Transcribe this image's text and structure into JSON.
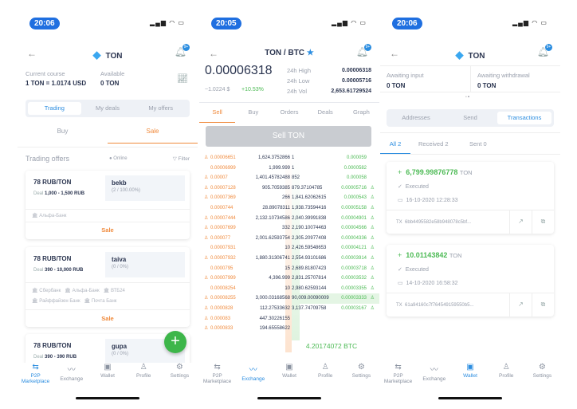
{
  "colors": {
    "accent": "#2b8de0",
    "sell": "#f08a3c",
    "buy": "#4cba54",
    "fab": "#3db64a"
  },
  "p1": {
    "time": "20:06",
    "title": "TON",
    "bell_badge": "9+",
    "course_label": "Current course",
    "course_value": "1 TON = 1.0174 USD",
    "available_label": "Available",
    "available_value": "0 TON",
    "seg": [
      "Trading",
      "My deals",
      "My offers"
    ],
    "tabs": [
      "Buy",
      "Sale"
    ],
    "offers_title": "Trading offers",
    "online": "Online",
    "filter": "Filter",
    "offers": [
      {
        "price": "78 RUB/TON",
        "deal_label": "Deal",
        "deal": "1,000 - 1,500 RUB",
        "user": "bekb",
        "stats": "(2 / 100.00%)",
        "banks": [
          "Альфа-Банк"
        ],
        "action": "Sale"
      },
      {
        "price": "78 RUB/TON",
        "deal_label": "Deal",
        "deal": "390 - 10,000 RUB",
        "user": "taiva",
        "stats": "(0 / 0%)",
        "banks": [
          "Сбербанк",
          "Альфа-Банк",
          "ВТБ24",
          "Райффайзен Банк",
          "Почта Банк"
        ],
        "action": "Sale"
      },
      {
        "price": "78 RUB/TON",
        "deal_label": "Deal",
        "deal": "390 - 390 RUB",
        "user": "gupa",
        "stats": "(0 / 0%)"
      }
    ],
    "fab": "+"
  },
  "p2": {
    "time": "20:05",
    "pair": "TON / BTC",
    "price": "0.00006318",
    "usd": "~1.0224 $",
    "change": "+10.53%",
    "high_label": "24h High",
    "high": "0.00006318",
    "low_label": "24h Low",
    "low": "0.00005716",
    "vol_label": "24h Vol",
    "vol": "2,653.61729524",
    "tabs": [
      "Sell",
      "Buy",
      "Orders",
      "Deals",
      "Graph"
    ],
    "sell_button": "Sell TON",
    "total": "4.20174072 BTC",
    "rows": [
      [
        "0.00006651",
        "1,624.3752866",
        "1",
        "0.000059",
        1,
        0
      ],
      [
        "0.00006999",
        "1,999.999",
        "1",
        "0.0000582",
        0,
        0
      ],
      [
        "0.00007",
        "1,401.45782488",
        "852",
        "0.000058",
        1,
        0
      ],
      [
        "0.00007128",
        "905.7059385",
        "879.37104785",
        "0.00005716",
        1,
        1
      ],
      [
        "0.00007369",
        "266",
        "1,841.62062615",
        "0.0000543",
        1,
        1
      ],
      [
        "0.0000744",
        "28.89078311",
        "1,938.73594416",
        "0.00005158",
        0,
        1
      ],
      [
        "0.00007444",
        "2,132.10734586",
        "2,040.39991838",
        "0.00004901",
        1,
        1
      ],
      [
        "0.00007699",
        "332",
        "2,190.10074463",
        "0.00004566",
        1,
        1
      ],
      [
        "0.000077",
        "2,001.62593754",
        "2,305.20977408",
        "0.00004336",
        1,
        1
      ],
      [
        "0.00007931",
        "10",
        "2,426.59548653",
        "0.00004121",
        0,
        1
      ],
      [
        "0.00007932",
        "1,880.31306741",
        "2,554.93101686",
        "0.00003914",
        1,
        1
      ],
      [
        "0.0000795",
        "15",
        "2,689.81807423",
        "0.00003718",
        0,
        1
      ],
      [
        "0.00007999",
        "4,396.999",
        "2,831.25707814",
        "0.00003532",
        1,
        1
      ],
      [
        "0.00008254",
        "10",
        "2,980.62593144",
        "0.00003355",
        0,
        1
      ],
      [
        "0.00008255",
        "3,000.03168568",
        "90,009.00090009",
        "0.00003333",
        1,
        1
      ],
      [
        "0.0000828",
        "112.27533632",
        "3,137.74709758",
        "0.00003167",
        1,
        1
      ],
      [
        "0.000083",
        "447.30226155",
        "",
        "",
        1,
        0
      ],
      [
        "0.0000833",
        "194.65558622",
        "",
        "",
        1,
        0
      ]
    ]
  },
  "p3": {
    "time": "20:06",
    "title": "TON",
    "in_label": "Awaiting input",
    "in_value": "0 TON",
    "out_label": "Awaiting withdrawal",
    "out_value": "0 TON",
    "seg": [
      "Addresses",
      "Send",
      "Transactions"
    ],
    "tabs": [
      "All 2",
      "Received 2",
      "Sent 0"
    ],
    "tx": [
      {
        "sign": "+",
        "amount": "6,799.99876778",
        "unit": "TON",
        "status": "Executed",
        "date": "16-10-2020 12:28:33",
        "tx_label": "TX",
        "hash": "6bb4495582e58b948078c5bf..."
      },
      {
        "sign": "+",
        "amount": "10.01143842",
        "unit": "TON",
        "status": "Executed",
        "date": "14-10-2020 16:58:32",
        "tx_label": "TX",
        "hash": "61a94160c7f764549159550b5..."
      }
    ]
  },
  "nav": [
    "P2P Marketplace",
    "Exchange",
    "Wallet",
    "Profile",
    "Settings"
  ]
}
